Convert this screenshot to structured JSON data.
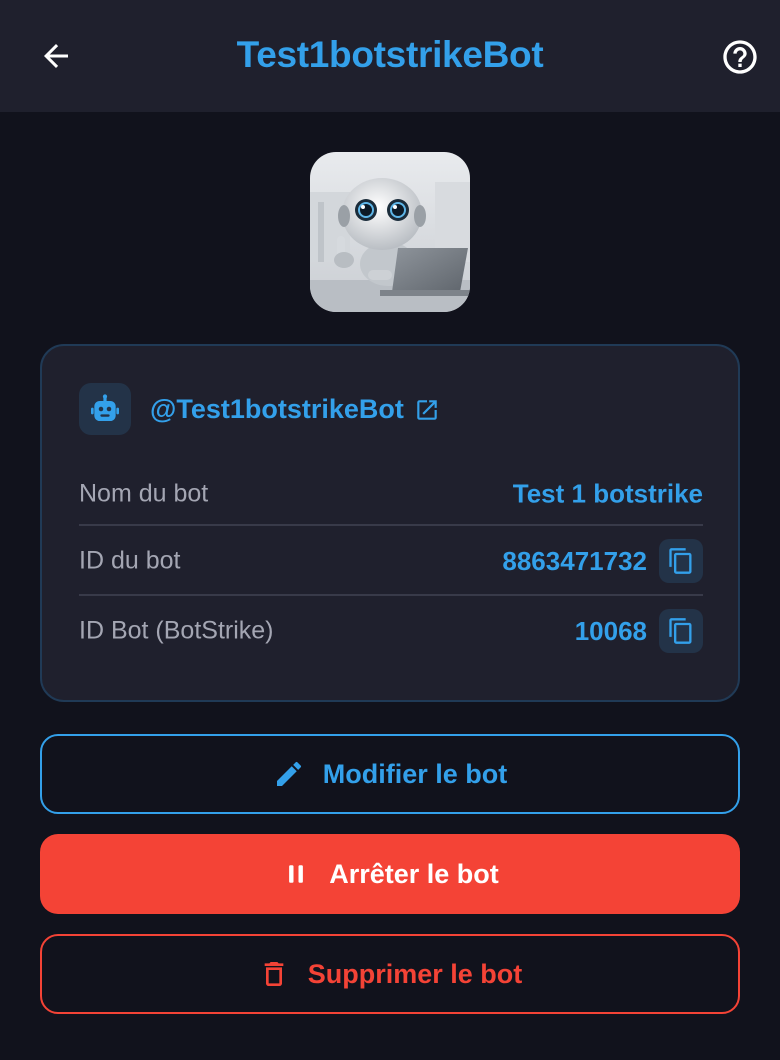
{
  "appbar": {
    "title": "Test1botstrikeBot",
    "back_icon": "arrow-left-icon",
    "help_icon": "help-circle-icon"
  },
  "bot": {
    "avatar": "robot-photo",
    "username": "@Test1botstrikeBot",
    "rows": [
      {
        "label": "Nom du bot",
        "value": "Test 1 botstrike",
        "copyable": false
      },
      {
        "label": "ID du bot",
        "value": "8863471732",
        "copyable": true
      },
      {
        "label": "ID Bot (BotStrike)",
        "value": "10068",
        "copyable": true
      }
    ]
  },
  "actions": {
    "edit_label": "Modifier le bot",
    "stop_label": "Arrêter le bot",
    "delete_label": "Supprimer le bot"
  },
  "colors": {
    "accent": "#33a0ea",
    "danger": "#f44336",
    "background": "#11121c",
    "surface": "#1f202d"
  }
}
